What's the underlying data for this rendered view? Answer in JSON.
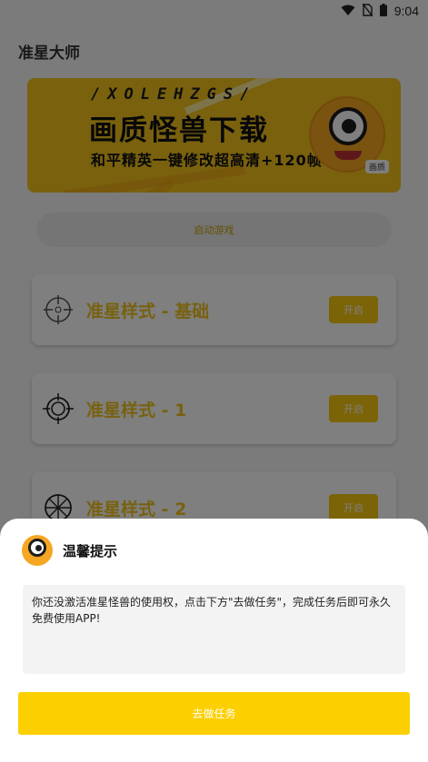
{
  "status_bar": {
    "time": "9:04",
    "icons": [
      "wifi-icon",
      "no-sim-icon",
      "battery-icon"
    ]
  },
  "app": {
    "title": "准星大师"
  },
  "banner": {
    "letters": "/XOLEHZGS/",
    "title": "画质怪兽下载",
    "subtitle": "和平精英一键修改超高清+120帧",
    "tag": "画质"
  },
  "launch_button": {
    "label": "启动游戏"
  },
  "crosshair_styles": [
    {
      "label": "准星样式 - 基础",
      "button": "开启",
      "icon": "crosshair-basic-icon"
    },
    {
      "label": "准星样式 - 1",
      "button": "开启",
      "icon": "crosshair-circle-icon"
    },
    {
      "label": "准星样式 - 2",
      "button": "开启",
      "icon": "crosshair-wheel-icon"
    }
  ],
  "dialog": {
    "title": "温馨提示",
    "message": "你还没激活准星怪兽的使用权，点击下方\"去做任务\"，完成任务后即可永久免费使用APP!",
    "action": "去做任务"
  },
  "colors": {
    "accent": "#f7c610",
    "accent_text": "#f1c21e",
    "action_button": "#fccf00",
    "banner": "#f3c21c"
  }
}
